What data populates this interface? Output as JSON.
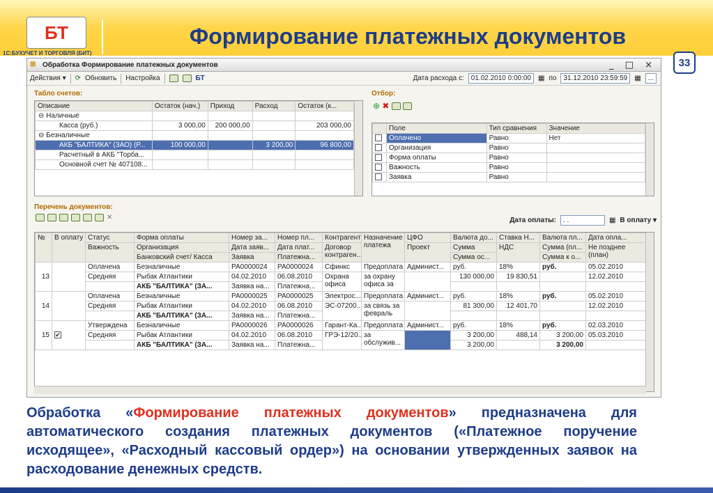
{
  "slide": {
    "title": "Формирование платежных документов",
    "page_number": "33",
    "logo_text": "БТ",
    "logo_caption": "1С:БУХУЧЕТ И ТОРГОВЛЯ (БИТ)",
    "description_prefix": "Обработка «",
    "description_highlight": "Формирование платежных документов",
    "description_suffix": "» предназначена для автоматического создания платежных документов («Платежное поручение исходящее», «Расходный кассовый ордер») на основании утвержденных заявок на расходование денежных средств."
  },
  "window": {
    "title": "Обработка  Формирование платежных документов",
    "controls": "_ □ ×",
    "toolbar": {
      "actions": "Действия ▾",
      "refresh": "Обновить",
      "settings": "Настройка",
      "date_label": "Дата расхода с:",
      "date_from": "01.02.2010  0:00:00",
      "date_to_label": "по",
      "date_to": "31.12.2010 23:59:59",
      "more": "..."
    },
    "accounts": {
      "header": "Табло счетов:",
      "columns": [
        "Описание",
        "Остаток (нач.)",
        "Приход",
        "Расход",
        "Остаток (к..."
      ],
      "rows": [
        {
          "desc": "⊖  Наличные",
          "start": "",
          "in": "",
          "out": "",
          "end": ""
        },
        {
          "desc": "Касса (руб.)",
          "start": "3 000,00",
          "in": "200 000,00",
          "out": "",
          "end": "203 000,00"
        },
        {
          "desc": "⊖  Безналичные",
          "start": "",
          "in": "",
          "out": "",
          "end": ""
        },
        {
          "desc": "АКБ \"БАЛТИКА\" (ЗАО) (Р...",
          "start": "100 000,00",
          "in": "",
          "out": "3 200,00",
          "end": "96 800,00"
        },
        {
          "desc": "Расчетный в АКБ \"Торба...",
          "start": "",
          "in": "",
          "out": "",
          "end": ""
        },
        {
          "desc": "Основной счет № 407108...",
          "start": "",
          "in": "",
          "out": "",
          "end": ""
        }
      ]
    },
    "filter": {
      "header": "Отбор:",
      "columns": [
        "Поле",
        "Тип сравнения",
        "Значение"
      ],
      "rows": [
        {
          "field": "Оплачено",
          "cmp": "Равно",
          "value": "Нет"
        },
        {
          "field": "Организация",
          "cmp": "Равно",
          "value": ""
        },
        {
          "field": "Форма оплаты",
          "cmp": "Равно",
          "value": ""
        },
        {
          "field": "Важность",
          "cmp": "Равно",
          "value": ""
        },
        {
          "field": "Заявка",
          "cmp": "Равно",
          "value": ""
        }
      ]
    },
    "documents": {
      "header": "Перечень документов:",
      "pay_date_label": "Дата оплаты:",
      "pay_date_value": ". .",
      "to_pay": "В оплату ▾",
      "head1": [
        "№",
        "В оплату",
        "Статус",
        "Форма оплаты",
        "Номер за...",
        "Номер пл...",
        "Контрагент",
        "Назначение платежа",
        "ЦФО",
        "Валюта до...",
        "Ставка Н...",
        "Валюта пл...",
        "Дата опла..."
      ],
      "head2": [
        "Важность",
        "Организация",
        "Дата заяв...",
        "Дата плат...",
        "Договор контраген...",
        "Проект",
        "Сумма",
        "НДС",
        "Сумма (пл...",
        "Не позднее (план)"
      ],
      "head3": [
        "Банковский счет/ Касса",
        "Заявка",
        "Платежна...",
        "Сумма ос...",
        "Сумма к о..."
      ],
      "rows": [
        {
          "n": "13",
          "status": "Оплачена",
          "importance": "Средняя",
          "form": "Безналичные",
          "org": "Рыбак Атлантики",
          "bank": "АКБ \"БАЛТИКА\" (ЗА...",
          "req_no": "РА0000024",
          "req_date": "04.02.2010",
          "req_doc": "Заявка на...",
          "pay_no": "РА0000024",
          "pay_date": "06.08.2010",
          "pay_doc": "Платежна...",
          "contr": "Сфинкс",
          "contract": "Охрана офиса",
          "purpose1": "Предоплата",
          "purpose2": "за охрану офиса за",
          "cfo": "Админист...",
          "cur": "руб.",
          "sum": "130 000,00",
          "rate": "18%",
          "vat": "19 830,51",
          "paycur": "руб.",
          "paysum": "",
          "paydate": "05.02.2010",
          "plan": "12.02.2010",
          "checked": ""
        },
        {
          "n": "14",
          "status": "Оплачена",
          "importance": "Средняя",
          "form": "Безналичные",
          "org": "Рыбак Атлантики",
          "bank": "АКБ \"БАЛТИКА\" (ЗА...",
          "req_no": "РА0000025",
          "req_date": "04.02.2010",
          "req_doc": "Заявка на...",
          "pay_no": "РА0000025",
          "pay_date": "06.08.2010",
          "pay_doc": "Платежна...",
          "contr": "Электрос...",
          "contract": "ЭС-07200...",
          "purpose1": "Предоплата",
          "purpose2": "за связь за февраль",
          "cfo": "Админист...",
          "cur": "руб.",
          "sum": "81 300,00",
          "rate": "18%",
          "vat": "12 401,70",
          "paycur": "руб.",
          "paysum": "",
          "paydate": "05.02.2010",
          "plan": "12.02.2010",
          "checked": ""
        },
        {
          "n": "15",
          "status": "Утверждена",
          "importance": "Средняя",
          "form": "Безналичные",
          "org": "Рыбак Атлантики",
          "bank": "АКБ \"БАЛТИКА\" (ЗА...",
          "req_no": "РА0000026",
          "req_date": "04.02.2010",
          "req_doc": "Заявка на...",
          "pay_no": "РА0000026",
          "pay_date": "06.08.2010",
          "pay_doc": "Платежна...",
          "contr": "Гарант-Ка...",
          "contract": "ГРЭ-12/20...",
          "purpose1": "Предоплата",
          "purpose2": "за обслужив...",
          "cfo": "Админист...",
          "cur": "руб.",
          "sum": "3 200,00",
          "rate": "18%",
          "vat": "488,14",
          "paycur": "руб.",
          "paysum": "3 200,00",
          "paydate": "02.03.2010",
          "plan": "05.03.2010",
          "checked": "✔",
          "rest": "3 200,00",
          "topay": "3 200,00"
        }
      ]
    }
  }
}
